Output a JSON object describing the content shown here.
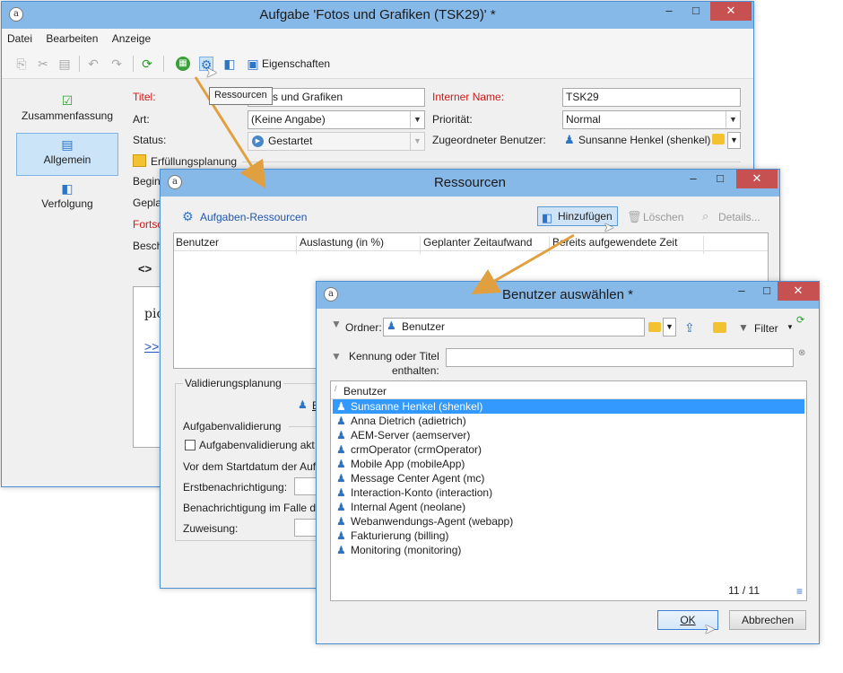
{
  "main_window": {
    "title": "Aufgabe 'Fotos und Grafiken (TSK29)' *",
    "menu": [
      "Datei",
      "Bearbeiten",
      "Anzeige"
    ],
    "toolbar": {
      "properties_label": "Eigenschaften",
      "tooltip": "Ressourcen"
    },
    "sidebar": [
      {
        "label": "Zusammenfassung",
        "icon": "checklist-icon"
      },
      {
        "label": "Allgemein",
        "icon": "clipboard-icon"
      },
      {
        "label": "Verfolgung",
        "icon": "tracking-icon"
      }
    ],
    "form": {
      "title_label": "Titel:",
      "title_value": "Fotos und Grafiken",
      "internal_name_label": "Interner Name:",
      "internal_name_value": "TSK29",
      "type_label": "Art:",
      "type_value": "(Keine Angabe)",
      "priority_label": "Priorität:",
      "priority_value": "Normal",
      "status_label": "Status:",
      "status_value": "Gestartet",
      "assigned_user_label": "Zugeordneter Benutzer:",
      "assigned_user_value": "Sunsanne Henkel (shenkel)",
      "planning_label": "Erfüllungsplanung",
      "start_label": "Begin",
      "planned_label": "Gepla",
      "progress_label": "Fortsc",
      "description_label": "Besch",
      "editor_text": "pict",
      "editor_link": ">>"
    }
  },
  "resources_window": {
    "title": "Ressourcen",
    "section_label": "Aufgaben-Ressourcen",
    "add_button": "Hinzufügen",
    "delete_button": "Löschen",
    "details_button": "Details...",
    "columns": [
      "Benutzer",
      "Auslastung (in %)",
      "Geplanter Zeitaufwand",
      "Bereits aufgewendete Zeit"
    ],
    "validation_planning_label": "Validierungsplanung",
    "validation_link": "E",
    "task_validation_label": "Aufgabenvalidierung",
    "task_validation_checkbox": "Aufgabenvalidierung akt",
    "before_start_label": "Vor dem Startdatum der Auf",
    "first_notification_label": "Erstbenachrichtigung:",
    "notification_case_label": "Benachrichtigung im Falle d",
    "assignment_label": "Zuweisung:"
  },
  "select_user_window": {
    "title": "Benutzer auswählen *",
    "folder_label": "Ordner:",
    "folder_value": "Benutzer",
    "filter_label": "Filter",
    "search_label_1": "Kennung oder Titel",
    "search_label_2": "enthalten:",
    "search_value": "",
    "list_header": "Benutzer",
    "users": [
      "Sunsanne Henkel (shenkel)",
      "Anna Dietrich (adietrich)",
      "AEM-Server (aemserver)",
      "crmOperator (crmOperator)",
      "Mobile App (mobileApp)",
      "Message Center Agent (mc)",
      "Interaction-Konto (interaction)",
      "Internal Agent (neolane)",
      "Webanwendungs-Agent (webapp)",
      "Fakturierung (billing)",
      "Monitoring (monitoring)"
    ],
    "selected_index": 0,
    "count": "11 / 11",
    "ok_button": "OK",
    "cancel_button": "Abbrechen"
  },
  "colors": {
    "titlebar": "#87b9e8",
    "selection": "#3399ff",
    "required_label": "#cc1a1a",
    "close_button": "#c75050",
    "arrow": "#e0a040"
  }
}
